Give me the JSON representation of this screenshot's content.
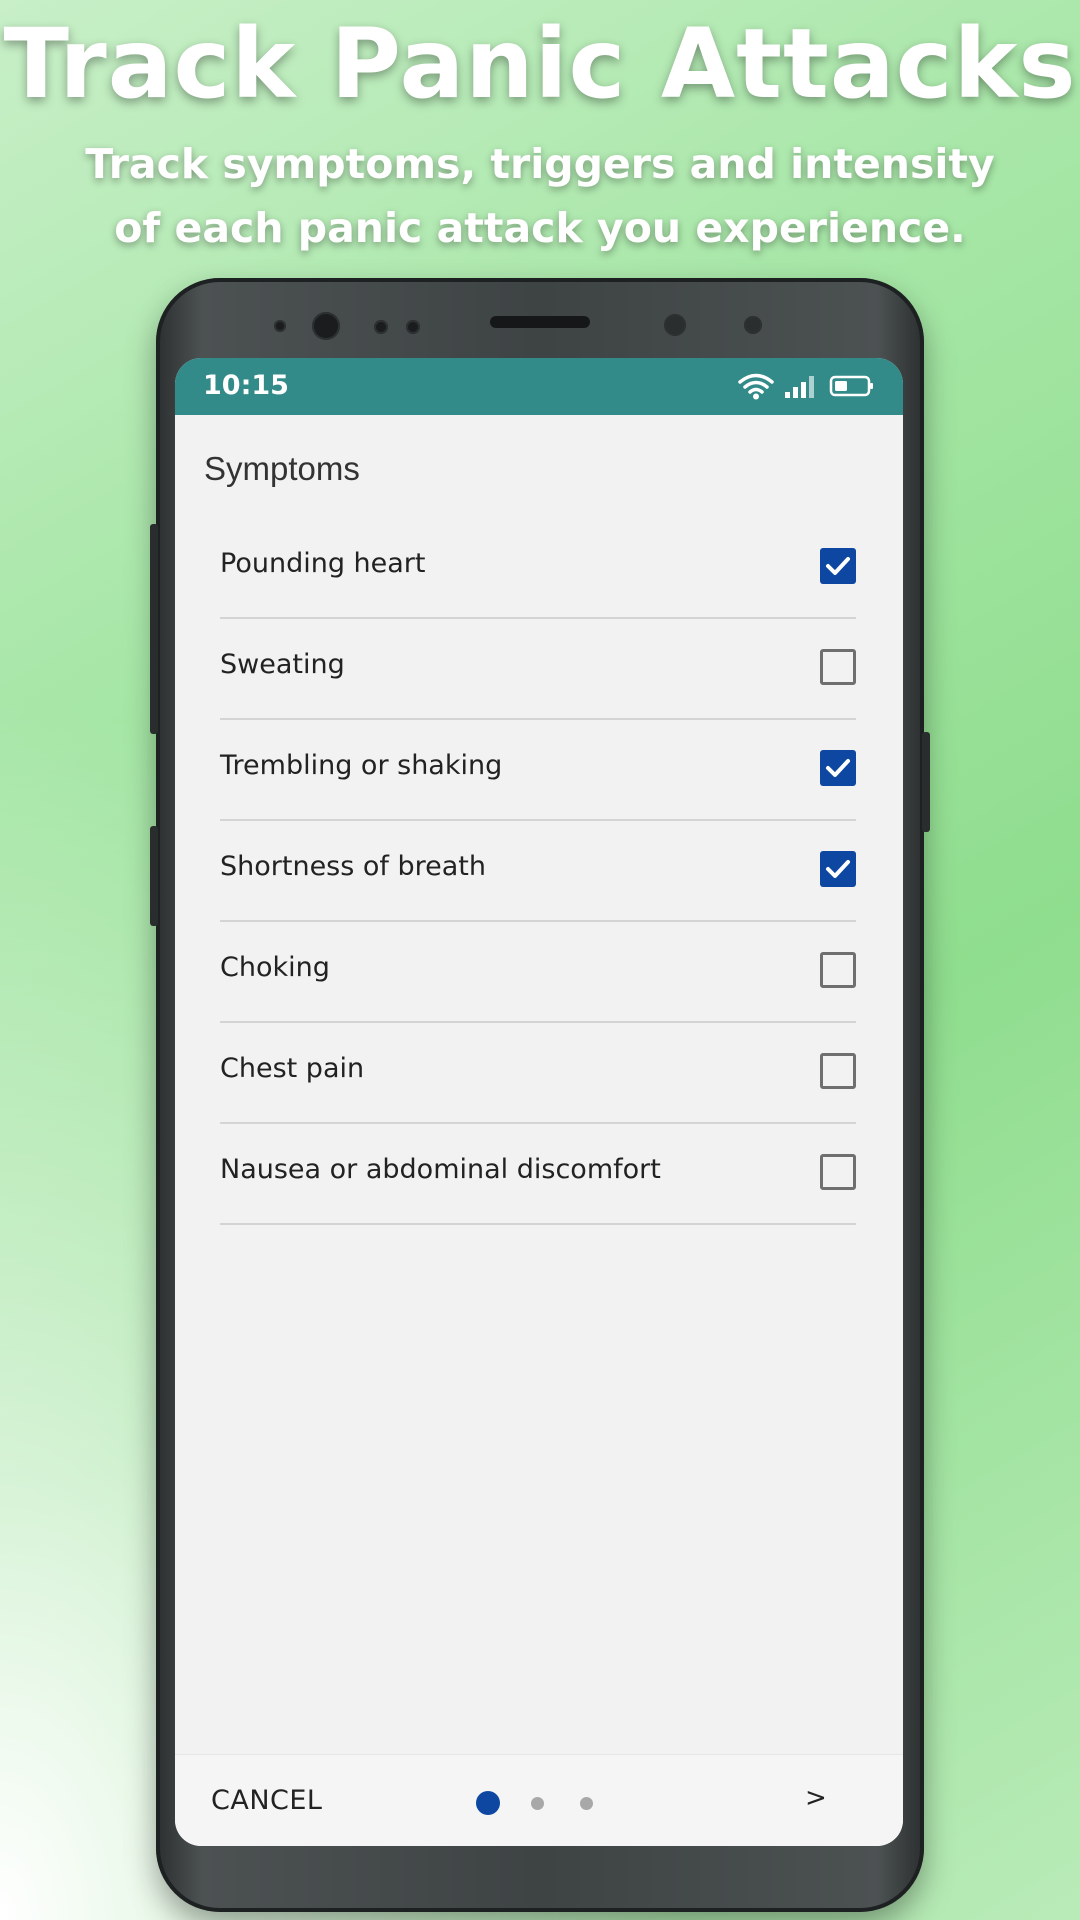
{
  "promo": {
    "headline": "Track Panic Attacks",
    "subhead": "Track symptoms, triggers and intensity of each panic attack you experience."
  },
  "status_bar": {
    "time": "10:15",
    "icons": [
      "wifi-icon",
      "signal-icon",
      "battery-icon"
    ],
    "color": "#338b89"
  },
  "screen": {
    "section_title": "Symptoms",
    "symptoms": [
      {
        "label": "Pounding heart",
        "checked": true
      },
      {
        "label": "Sweating",
        "checked": false
      },
      {
        "label": "Trembling or shaking",
        "checked": true
      },
      {
        "label": "Shortness of breath",
        "checked": true
      },
      {
        "label": "Choking",
        "checked": false
      },
      {
        "label": "Chest pain",
        "checked": false
      },
      {
        "label": "Nausea or abdominal discomfort",
        "checked": false
      }
    ],
    "checkbox_color": "#0d47a1"
  },
  "bottom_bar": {
    "cancel_label": "CANCEL",
    "next_label": ">",
    "page_indicator": {
      "pages": 3,
      "current": 1
    },
    "active_dot_color": "#0d47a1",
    "inactive_dot_color": "#a8a8a8"
  }
}
